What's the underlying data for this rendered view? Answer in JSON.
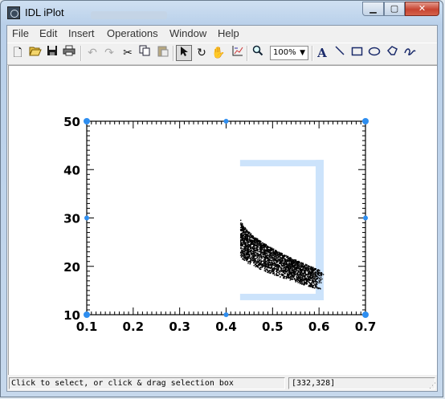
{
  "window": {
    "title": "IDL iPlot",
    "minimize_icon": "minimize-icon",
    "maximize_icon": "maximize-icon",
    "close_icon": "close-icon"
  },
  "menu": {
    "items": [
      "File",
      "Edit",
      "Insert",
      "Operations",
      "Window",
      "Help"
    ]
  },
  "toolbar": {
    "zoom_value": "100%",
    "tools": [
      {
        "name": "new-icon"
      },
      {
        "name": "open-icon"
      },
      {
        "name": "save-icon"
      },
      {
        "name": "print-icon"
      },
      {
        "name": "undo-icon"
      },
      {
        "name": "redo-icon"
      },
      {
        "name": "cut-icon"
      },
      {
        "name": "copy-icon"
      },
      {
        "name": "paste-icon"
      },
      {
        "name": "select-arrow-icon"
      },
      {
        "name": "rotate-icon"
      },
      {
        "name": "pan-hand-icon"
      },
      {
        "name": "data-range-icon"
      },
      {
        "name": "zoom-icon"
      },
      {
        "name": "text-icon"
      },
      {
        "name": "line-icon"
      },
      {
        "name": "rectangle-icon"
      },
      {
        "name": "ellipse-icon"
      },
      {
        "name": "polygon-icon"
      },
      {
        "name": "freehand-icon"
      }
    ]
  },
  "status": {
    "message": "Click to select, or click & drag selection box",
    "coords": "[332,328]"
  },
  "colors": {
    "handle": "#2e8ef0",
    "selection": "#cce3fb",
    "points": "#000000"
  },
  "chart_data": {
    "type": "scatter",
    "xlim": [
      0.1,
      0.7
    ],
    "ylim": [
      10,
      50
    ],
    "xticks": [
      "0.1",
      "0.2",
      "0.3",
      "0.4",
      "0.5",
      "0.6",
      "0.7"
    ],
    "yticks": [
      "10",
      "20",
      "30",
      "40",
      "50"
    ],
    "point_cloud": {
      "x_range": [
        0.43,
        0.61
      ],
      "y_top_at_x_start": 30,
      "y_top_at_x_end": 19,
      "y_bottom_at_x_start": 22,
      "y_bottom_at_x_end": 15,
      "count": 2600
    },
    "selection_box": {
      "x": [
        0.43,
        0.61
      ],
      "y": [
        13,
        42
      ]
    },
    "xlabel": "",
    "ylabel": "",
    "title": ""
  }
}
